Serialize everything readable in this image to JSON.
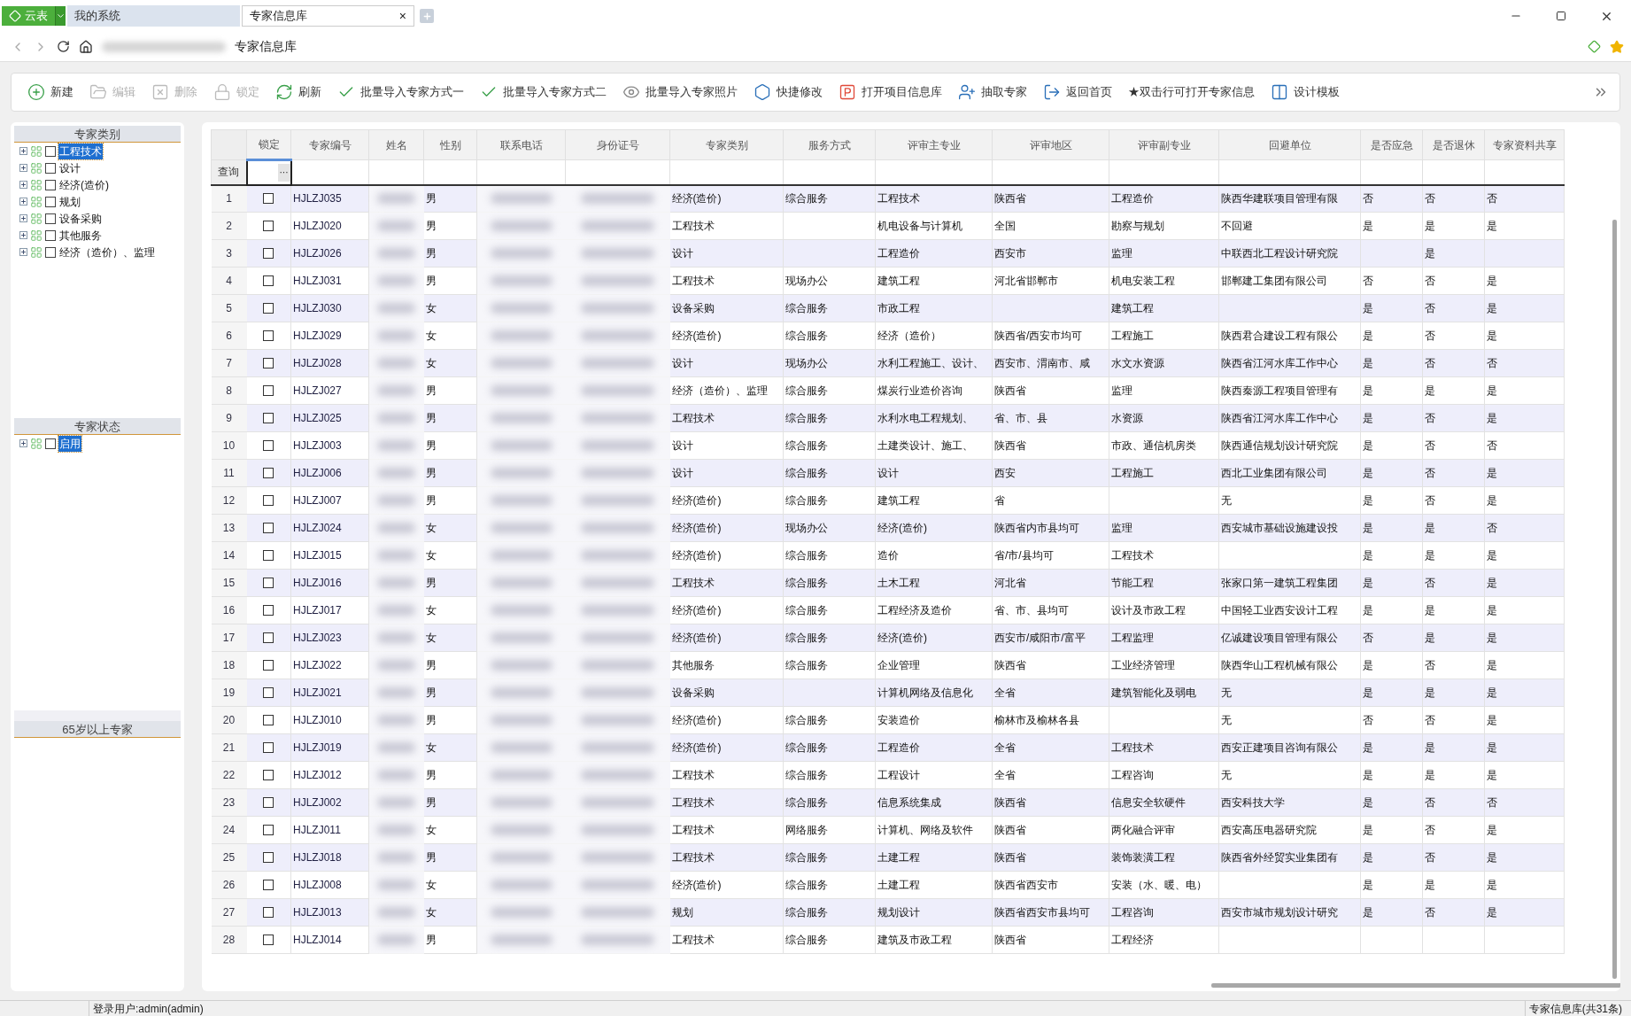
{
  "app_button": {
    "label": "云表"
  },
  "tabs": [
    {
      "label": "我的系统",
      "selected": false
    },
    {
      "label": "专家信息库",
      "selected": true,
      "close": "×"
    }
  ],
  "address_bar": {
    "title": "专家信息库"
  },
  "toolbar": [
    {
      "kind": "new",
      "label": "新建",
      "disabled": false
    },
    {
      "kind": "edit",
      "label": "编辑",
      "disabled": true
    },
    {
      "kind": "delete",
      "label": "删除",
      "disabled": true
    },
    {
      "kind": "lock",
      "label": "锁定",
      "disabled": true
    },
    {
      "kind": "refresh",
      "label": "刷新",
      "disabled": false
    },
    {
      "kind": "import",
      "label": "批量导入专家方式一",
      "disabled": false
    },
    {
      "kind": "import",
      "label": "批量导入专家方式二",
      "disabled": false
    },
    {
      "kind": "photo",
      "label": "批量导入专家照片",
      "disabled": false
    },
    {
      "kind": "quick",
      "label": "快捷修改",
      "disabled": false
    },
    {
      "kind": "project",
      "label": "打开项目信息库",
      "disabled": false
    },
    {
      "kind": "extract",
      "label": "抽取专家",
      "disabled": false
    },
    {
      "kind": "home",
      "label": "返回首页",
      "disabled": false
    },
    {
      "kind": "hint",
      "label": "★双击行可打开专家信息",
      "disabled": false
    },
    {
      "kind": "template",
      "label": "设计模板",
      "disabled": false
    }
  ],
  "sidebar": [
    {
      "title": "专家类别",
      "items": [
        {
          "label": "工程技术",
          "checked": false,
          "selected": true
        },
        {
          "label": "设计",
          "checked": false,
          "selected": false
        },
        {
          "label": "经济(造价)",
          "checked": false,
          "selected": false
        },
        {
          "label": "规划",
          "checked": false,
          "selected": false
        },
        {
          "label": "设备采购",
          "checked": false,
          "selected": false
        },
        {
          "label": "其他服务",
          "checked": false,
          "selected": false
        },
        {
          "label": "经济（造价）、监理",
          "checked": false,
          "selected": false
        }
      ]
    },
    {
      "title": "专家状态",
      "items": [
        {
          "label": "启用",
          "checked": false,
          "selected": true
        }
      ]
    },
    {
      "title": "65岁以上专家"
    }
  ],
  "table": {
    "columns": [
      "锁定",
      "专家编号",
      "姓名",
      "性别",
      "联系电话",
      "身份证号",
      "专家类别",
      "服务方式",
      "评审主专业",
      "评审地区",
      "评审副专业",
      "回避单位",
      "是否应急",
      "是否退休",
      "专家资料共享"
    ],
    "filter": {
      "label": "查询",
      "button": "···"
    },
    "rows": [
      {
        "no": "1",
        "locked": false,
        "code": "HJLZJ035",
        "gender": "男",
        "category": "经济(造价)",
        "service": "综合服务",
        "major": "工程技术",
        "region": "陕西省",
        "minor": "工程造价",
        "avoid": "陕西华建联项目管理有限",
        "emergency": "否",
        "retired": "否",
        "share": "否"
      },
      {
        "no": "2",
        "locked": false,
        "code": "HJLZJ020",
        "gender": "男",
        "category": "工程技术",
        "major": "机电设备与计算机",
        "region": "全国",
        "minor": "勘察与规划",
        "avoid": "不回避",
        "emergency": "是",
        "retired": "是",
        "share": "是"
      },
      {
        "no": "3",
        "locked": false,
        "code": "HJLZJ026",
        "gender": "男",
        "category": "设计",
        "major": "工程造价",
        "region": "西安市",
        "minor": "监理",
        "avoid": "中联西北工程设计研究院",
        "retired": "是"
      },
      {
        "no": "4",
        "locked": false,
        "code": "HJLZJ031",
        "gender": "男",
        "category": "工程技术",
        "service": "现场办公",
        "major": "建筑工程",
        "region": "河北省邯郸市",
        "minor": "机电安装工程",
        "avoid": "邯郸建工集团有限公司",
        "emergency": "否",
        "retired": "否",
        "share": "是"
      },
      {
        "no": "5",
        "locked": false,
        "code": "HJLZJ030",
        "gender": "女",
        "category": "设备采购",
        "service": "综合服务",
        "major": "市政工程",
        "minor": "建筑工程",
        "emergency": "是",
        "retired": "否",
        "share": "是"
      },
      {
        "no": "6",
        "locked": false,
        "code": "HJLZJ029",
        "gender": "女",
        "category": "经济(造价)",
        "service": "综合服务",
        "major": "经济（造价）",
        "region": "陕西省/西安市均可",
        "minor": "工程施工",
        "avoid": "陕西君合建设工程有限公",
        "emergency": "是",
        "retired": "否",
        "share": "是"
      },
      {
        "no": "7",
        "locked": false,
        "code": "HJLZJ028",
        "gender": "女",
        "category": "设计",
        "service": "现场办公",
        "major": "水利工程施工、设计、",
        "region": "西安市、渭南市、咸",
        "minor": "水文水资源",
        "avoid": "陕西省江河水库工作中心",
        "emergency": "是",
        "retired": "否",
        "share": "否"
      },
      {
        "no": "8",
        "locked": false,
        "code": "HJLZJ027",
        "gender": "男",
        "category": "经济（造价）、监理",
        "service": "综合服务",
        "major": "煤炭行业造价咨询",
        "region": "陕西省",
        "minor": "监理",
        "avoid": "陕西秦源工程项目管理有",
        "emergency": "是",
        "retired": "是",
        "share": "是"
      },
      {
        "no": "9",
        "locked": false,
        "code": "HJLZJ025",
        "gender": "男",
        "category": "工程技术",
        "service": "综合服务",
        "major": "水利水电工程规划、",
        "region": "省、市、县",
        "minor": "水资源",
        "avoid": "陕西省江河水库工作中心",
        "emergency": "是",
        "retired": "否",
        "share": "是"
      },
      {
        "no": "10",
        "locked": false,
        "code": "HJLZJ003",
        "gender": "男",
        "category": "设计",
        "service": "综合服务",
        "major": "土建类设计、施工、",
        "region": "陕西省",
        "minor": "市政、通信机房类",
        "avoid": "陕西通信规划设计研究院",
        "emergency": "是",
        "retired": "否",
        "share": "否"
      },
      {
        "no": "11",
        "locked": false,
        "code": "HJLZJ006",
        "gender": "男",
        "category": "设计",
        "service": "综合服务",
        "major": "设计",
        "region": "西安",
        "minor": "工程施工",
        "avoid": "西北工业集团有限公司",
        "emergency": "是",
        "retired": "否",
        "share": "是"
      },
      {
        "no": "12",
        "locked": false,
        "code": "HJLZJ007",
        "gender": "男",
        "category": "经济(造价)",
        "service": "综合服务",
        "major": "建筑工程",
        "region": "省",
        "avoid": "无",
        "emergency": "是",
        "retired": "否",
        "share": "是"
      },
      {
        "no": "13",
        "locked": false,
        "code": "HJLZJ024",
        "gender": "女",
        "category": "经济(造价)",
        "service": "现场办公",
        "major": "经济(造价)",
        "region": "陕西省内市县均可",
        "minor": "监理",
        "avoid": "西安城市基础设施建设投",
        "emergency": "是",
        "retired": "是",
        "share": "否"
      },
      {
        "no": "14",
        "locked": false,
        "code": "HJLZJ015",
        "gender": "女",
        "category": "经济(造价)",
        "service": "综合服务",
        "major": "造价",
        "region": "省/市/县均可",
        "minor": "工程技术",
        "emergency": "是",
        "retired": "是",
        "share": "是"
      },
      {
        "no": "15",
        "locked": false,
        "code": "HJLZJ016",
        "gender": "男",
        "category": "工程技术",
        "service": "综合服务",
        "major": "土木工程",
        "region": "河北省",
        "minor": "节能工程",
        "avoid": "张家口第一建筑工程集团",
        "emergency": "是",
        "retired": "否",
        "share": "是"
      },
      {
        "no": "16",
        "locked": false,
        "code": "HJLZJ017",
        "gender": "女",
        "category": "经济(造价)",
        "service": "综合服务",
        "major": "工程经济及造价",
        "region": "省、市、县均可",
        "minor": "设计及市政工程",
        "avoid": "中国轻工业西安设计工程",
        "emergency": "是",
        "retired": "是",
        "share": "是"
      },
      {
        "no": "17",
        "locked": false,
        "code": "HJLZJ023",
        "gender": "女",
        "category": "经济(造价)",
        "service": "综合服务",
        "major": "经济(造价)",
        "region": "西安市/咸阳市/富平",
        "minor": "工程监理",
        "avoid": "亿诚建设项目管理有限公",
        "emergency": "否",
        "retired": "是",
        "share": "是"
      },
      {
        "no": "18",
        "locked": false,
        "code": "HJLZJ022",
        "gender": "男",
        "category": "其他服务",
        "service": "综合服务",
        "major": "企业管理",
        "region": "陕西省",
        "minor": "工业经济管理",
        "avoid": "陕西华山工程机械有限公",
        "emergency": "是",
        "retired": "否",
        "share": "是"
      },
      {
        "no": "19",
        "locked": false,
        "code": "HJLZJ021",
        "gender": "男",
        "category": "设备采购",
        "major": "计算机网络及信息化",
        "region": "全省",
        "minor": "建筑智能化及弱电",
        "avoid": "无",
        "emergency": "是",
        "retired": "是",
        "share": "是"
      },
      {
        "no": "20",
        "locked": false,
        "code": "HJLZJ010",
        "gender": "男",
        "category": "经济(造价)",
        "service": "综合服务",
        "major": "安装造价",
        "region": "榆林市及榆林各县",
        "avoid": "无",
        "emergency": "否",
        "retired": "否",
        "share": "是"
      },
      {
        "no": "21",
        "locked": false,
        "code": "HJLZJ019",
        "gender": "女",
        "category": "经济(造价)",
        "service": "综合服务",
        "major": "工程造价",
        "region": "全省",
        "minor": "工程技术",
        "avoid": "西安正建项目咨询有限公",
        "emergency": "是",
        "retired": "是",
        "share": "是"
      },
      {
        "no": "22",
        "locked": false,
        "code": "HJLZJ012",
        "gender": "男",
        "category": "工程技术",
        "service": "综合服务",
        "major": "工程设计",
        "region": "全省",
        "minor": "工程咨询",
        "avoid": "无",
        "emergency": "是",
        "retired": "是",
        "share": "是"
      },
      {
        "no": "23",
        "locked": false,
        "code": "HJLZJ002",
        "gender": "男",
        "category": "工程技术",
        "service": "综合服务",
        "major": "信息系统集成",
        "region": "陕西省",
        "minor": "信息安全软硬件",
        "avoid": "西安科技大学",
        "emergency": "是",
        "retired": "否",
        "share": "否"
      },
      {
        "no": "24",
        "locked": false,
        "code": "HJLZJ011",
        "gender": "女",
        "category": "工程技术",
        "service": "网络服务",
        "major": "计算机、网络及软件",
        "region": "陕西省",
        "minor": "两化融合评审",
        "avoid": "西安高压电器研究院",
        "emergency": "是",
        "retired": "否",
        "share": "是"
      },
      {
        "no": "25",
        "locked": false,
        "code": "HJLZJ018",
        "gender": "男",
        "category": "工程技术",
        "service": "综合服务",
        "major": "土建工程",
        "region": "陕西省",
        "minor": "装饰装潢工程",
        "avoid": "陕西省外经贸实业集团有",
        "emergency": "是",
        "retired": "否",
        "share": "是"
      },
      {
        "no": "26",
        "locked": false,
        "code": "HJLZJ008",
        "gender": "女",
        "category": "经济(造价)",
        "service": "综合服务",
        "major": "土建工程",
        "region": "陕西省西安市",
        "minor": "安装（水、暖、电）",
        "emergency": "是",
        "retired": "是",
        "share": "是"
      },
      {
        "no": "27",
        "locked": false,
        "code": "HJLZJ013",
        "gender": "女",
        "category": "规划",
        "service": "综合服务",
        "major": "规划设计",
        "region": "陕西省西安市县均可",
        "minor": "工程咨询",
        "avoid": "西安市城市规划设计研究",
        "emergency": "是",
        "retired": "否",
        "share": "是"
      },
      {
        "no": "28",
        "locked": false,
        "code": "HJLZJ014",
        "gender": "男",
        "category": "工程技术",
        "service": "综合服务",
        "major": "建筑及市政工程",
        "region": "陕西省",
        "minor": "工程经济"
      }
    ]
  },
  "status_bar": {
    "user": "登录用户:admin(admin)",
    "count": "专家信息库(共31条)"
  }
}
